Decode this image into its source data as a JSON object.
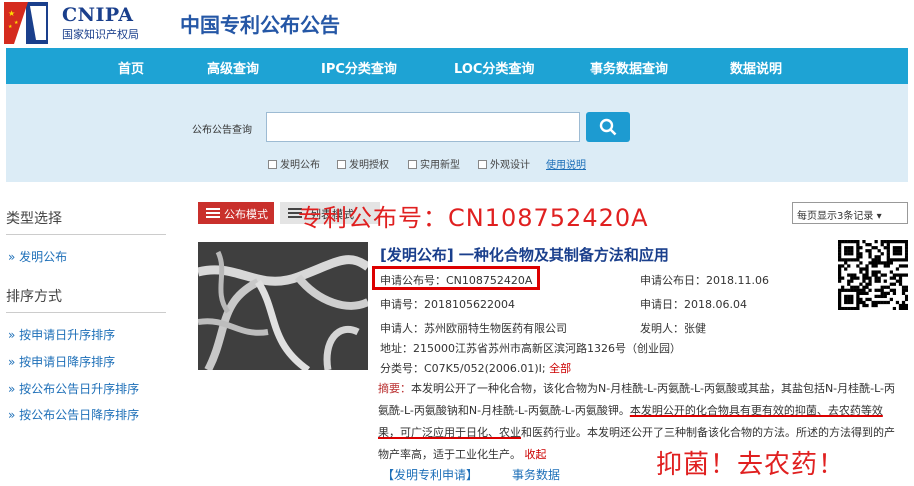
{
  "header": {
    "logo_text": "CNIPA",
    "logo_subtitle": "国家知识产权局",
    "site_title": "中国专利公布公告"
  },
  "nav": {
    "items": [
      "首页",
      "高级查询",
      "IPC分类查询",
      "LOC分类查询",
      "事务数据查询",
      "数据说明"
    ]
  },
  "search": {
    "label": "公布公告查询",
    "input_value": "",
    "button_icon": "search-icon",
    "checkboxes": [
      "发明公布",
      "发明授权",
      "实用新型",
      "外观设计"
    ],
    "help_link": "使用说明"
  },
  "sidebar": {
    "type_heading": "类型选择",
    "type_items": [
      "发明公布"
    ],
    "sort_heading": "排序方式",
    "sort_items": [
      "按申请日升序排序",
      "按申请日降序排序",
      "按公布公告日升序排序",
      "按公布公告日降序排序"
    ]
  },
  "toolbar": {
    "mode_label": "公布模式",
    "list_label": "列表模式",
    "per_page": "每页显示3条记录"
  },
  "overlay": {
    "title": "专利公布号：CN108752420A",
    "note": "抑菌！去农药！"
  },
  "record": {
    "title": "[发明公布] 一种化合物及其制备方法和应用",
    "pub_no": "申请公布号：CN108752420A",
    "pub_date": "申请公布日：2018.11.06",
    "app_no": "申请号：2018105622004",
    "app_date": "申请日：2018.06.04",
    "applicant": "申请人：苏州欧丽特生物医药有限公司",
    "inventor": "发明人：张健",
    "address": "地址：215000江苏省苏州市高新区滨河路1326号（创业园）",
    "class_no": "分类号：C07K5/052(2006.01)I;",
    "class_all": "全部",
    "abstract_label": "摘要：",
    "abstract_a": "本发明公开了一种化合物，该化合物为N-月桂酰-L-丙氨酰-L-丙氨酸或其盐，其盐包括N-月桂酰-L-丙氨酰-L-丙氨酸钠和N-月桂酰-L-丙氨酰-L-丙氨酸钾。",
    "abstract_b": "本发明公开的化合物具有更有效的抑菌、去农药等效果，可广泛应用于日化、农业",
    "abstract_c": "和医药行业。本发明还公开了三种制备该化合物的方法。所述的方法得到的产物产率高，适于工业化生产。",
    "abstract_more": "收起",
    "app_link": "【发明专利申请】",
    "biz_link": "事务数据"
  }
}
